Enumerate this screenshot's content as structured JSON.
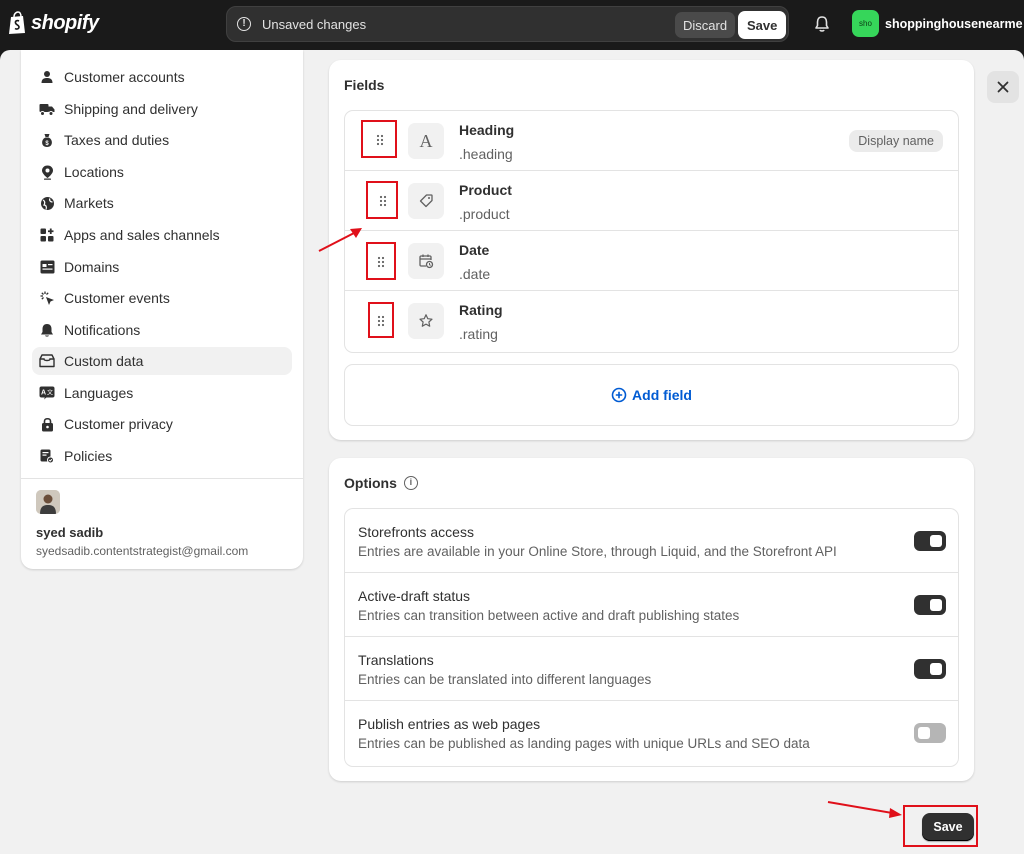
{
  "topbar": {
    "brand": "shopify",
    "unsaved_text": "Unsaved changes",
    "discard_label": "Discard",
    "save_label": "Save",
    "store_avatar_text": "sho",
    "store_name": "shoppinghousenearme"
  },
  "sidebar": {
    "items": [
      {
        "label": "Customer accounts",
        "icon": "person-icon"
      },
      {
        "label": "Shipping and delivery",
        "icon": "truck-icon"
      },
      {
        "label": "Taxes and duties",
        "icon": "money-bag-icon"
      },
      {
        "label": "Locations",
        "icon": "location-pin-icon"
      },
      {
        "label": "Markets",
        "icon": "globe-icon"
      },
      {
        "label": "Apps and sales channels",
        "icon": "apps-icon"
      },
      {
        "label": "Domains",
        "icon": "domain-icon"
      },
      {
        "label": "Customer events",
        "icon": "cursor-click-icon"
      },
      {
        "label": "Notifications",
        "icon": "bell-icon"
      },
      {
        "label": "Custom data",
        "icon": "database-icon",
        "active": true
      },
      {
        "label": "Languages",
        "icon": "language-icon"
      },
      {
        "label": "Customer privacy",
        "icon": "lock-icon"
      },
      {
        "label": "Policies",
        "icon": "policy-icon"
      }
    ],
    "user": {
      "name": "syed sadib",
      "email": "syedsadib.contentstrategist@gmail.com"
    }
  },
  "fields_card": {
    "title": "Fields",
    "fields": [
      {
        "name": "Heading",
        "key": ".heading",
        "icon": "text-icon",
        "badge": "Display name"
      },
      {
        "name": "Product",
        "key": ".product",
        "icon": "product-tag-icon"
      },
      {
        "name": "Date",
        "key": ".date",
        "icon": "calendar-clock-icon"
      },
      {
        "name": "Rating",
        "key": ".rating",
        "icon": "star-icon"
      }
    ],
    "add_field_label": "Add field"
  },
  "options_card": {
    "title": "Options",
    "options": [
      {
        "title": "Storefronts access",
        "description": "Entries are available in your Online Store, through Liquid, and the Storefront API",
        "enabled": true
      },
      {
        "title": "Active-draft status",
        "description": "Entries can transition between active and draft publishing states",
        "enabled": true
      },
      {
        "title": "Translations",
        "description": "Entries can be translated into different languages",
        "enabled": true
      },
      {
        "title": "Publish entries as web pages",
        "description": "Entries can be published as landing pages with unique URLs and SEO data",
        "enabled": false
      }
    ]
  },
  "footer": {
    "save_label": "Save"
  },
  "colors": {
    "annotation_red": "#e0101a",
    "link_blue": "#005bd3",
    "store_green": "#36d65a"
  }
}
